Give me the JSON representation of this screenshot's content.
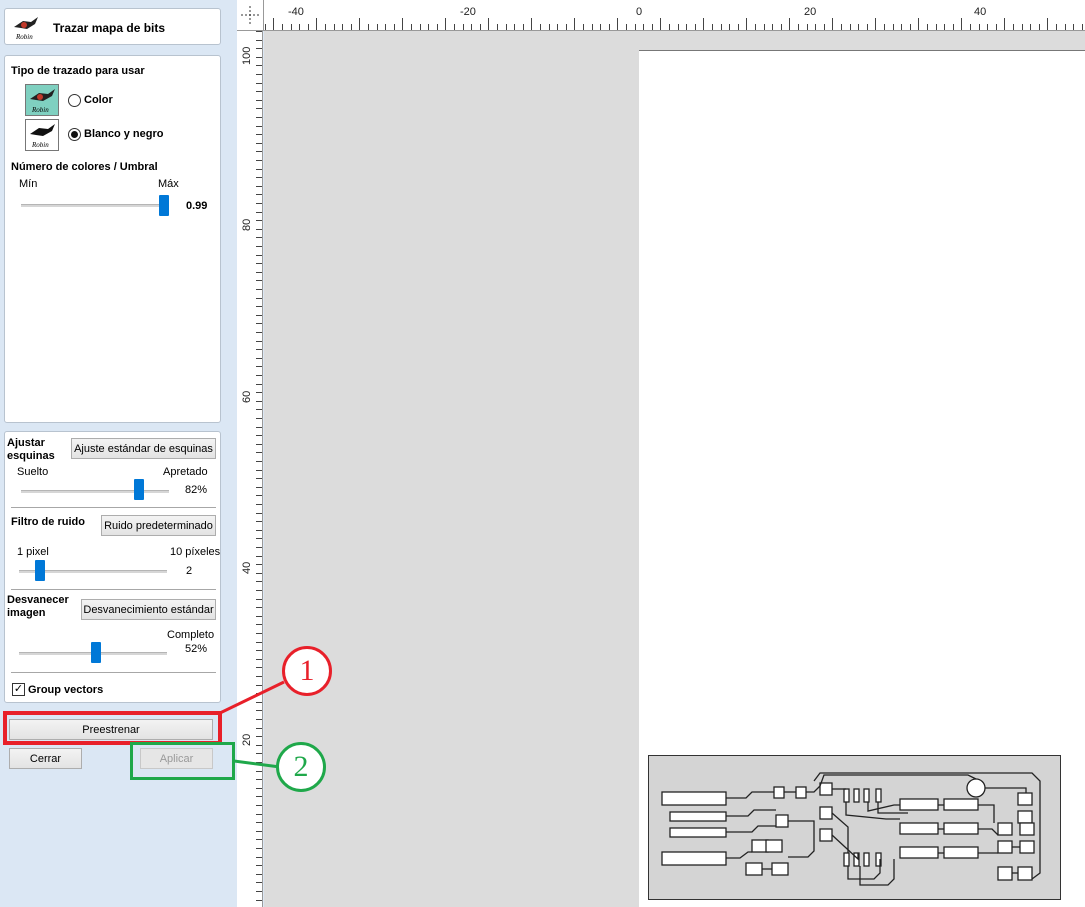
{
  "header": {
    "title": "Trazar mapa de bits",
    "icon": "robin-bird-icon"
  },
  "trace_type": {
    "heading": "Tipo de trazado para usar",
    "options": [
      {
        "label": "Color",
        "selected": false,
        "icon": "robin-color-icon"
      },
      {
        "label": "Blanco y negro",
        "selected": true,
        "icon": "robin-bw-icon"
      }
    ]
  },
  "threshold": {
    "heading": "Número de colores / Umbral",
    "min_label": "Mín",
    "max_label": "Máx",
    "value": "0.99"
  },
  "corners": {
    "heading": "Ajustar esquinas",
    "button": "Ajuste estándar de esquinas",
    "left_label": "Suelto",
    "right_label": "Apretado",
    "value": "82%"
  },
  "noise": {
    "heading": "Filtro de ruido",
    "button": "Ruido predeterminado",
    "left_label": "1 pixel",
    "right_label": "10 píxeles",
    "value": "2"
  },
  "fade": {
    "heading": "Desvanecer imagen",
    "button": "Desvanecimiento estándar",
    "right_label": "Completo",
    "value": "52%"
  },
  "group_vectors": {
    "label": "Group vectors",
    "checked": true
  },
  "actions": {
    "preview": "Preestrenar",
    "close": "Cerrar",
    "apply": "Aplicar"
  },
  "annotations": [
    {
      "number": "1",
      "color": "#e8202a"
    },
    {
      "number": "2",
      "color": "#1fa84a"
    }
  ],
  "ruler": {
    "top_labels": [
      "-40",
      "-20",
      "0",
      "20",
      "40"
    ],
    "left_labels": [
      "100",
      "80",
      "60",
      "40",
      "20"
    ]
  },
  "colors": {
    "accent": "#0078d7",
    "panel_bg": "#dbe7f4"
  }
}
